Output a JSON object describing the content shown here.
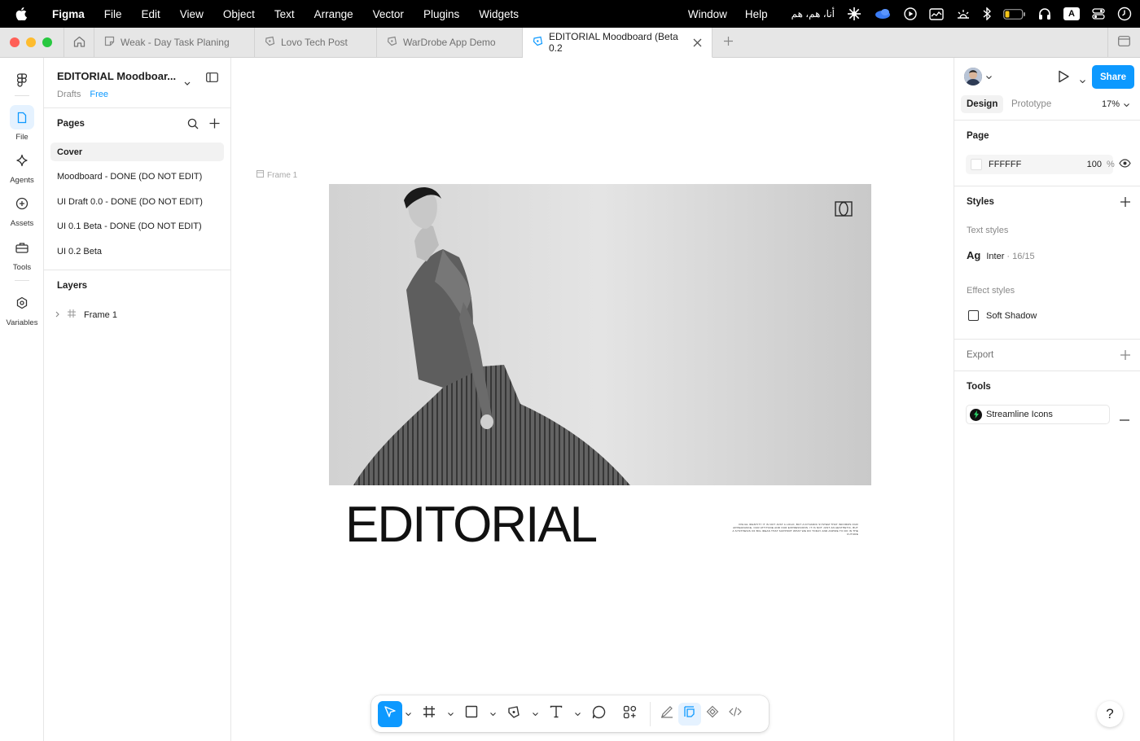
{
  "menubar": {
    "app_name": "Figma",
    "items": [
      "File",
      "Edit",
      "View",
      "Object",
      "Text",
      "Arrange",
      "Vector",
      "Plugins",
      "Widgets"
    ],
    "right_items": [
      "Window",
      "Help"
    ],
    "arabic_text": "أنا، هم، هم",
    "keyboard_indicator": "A"
  },
  "tabs": {
    "items": [
      {
        "label": "Weak - Day Task Planing",
        "icon": "figjam-icon"
      },
      {
        "label": "Lovo Tech Post",
        "icon": "pen-icon"
      },
      {
        "label": "WarDrobe App Demo",
        "icon": "pen-icon"
      },
      {
        "label": "EDITORIAL Moodboard (Beta 0.2",
        "icon": "pen-icon",
        "active": true
      }
    ]
  },
  "rail": {
    "items": [
      {
        "label": "File",
        "icon": "file-icon",
        "selected": true
      },
      {
        "label": "Agents",
        "icon": "sparkle-icon"
      },
      {
        "label": "Assets",
        "icon": "assets-icon"
      },
      {
        "label": "Tools",
        "icon": "toolbox-icon"
      },
      {
        "label": "Variables",
        "icon": "variables-icon"
      }
    ]
  },
  "file": {
    "title": "EDITORIAL Moodboar...",
    "location": "Drafts",
    "plan": "Free"
  },
  "pages": {
    "header": "Pages",
    "items": [
      {
        "label": "Cover",
        "selected": true
      },
      {
        "label": "Moodboard - DONE (DO NOT EDIT)"
      },
      {
        "label": "UI Draft 0.0 - DONE (DO NOT EDIT)"
      },
      {
        "label": "UI 0.1 Beta - DONE (DO NOT EDIT)"
      },
      {
        "label": "UI 0.2 Beta"
      }
    ]
  },
  "layers": {
    "header": "Layers",
    "items": [
      {
        "label": "Frame 1",
        "icon": "frame-icon"
      }
    ]
  },
  "canvas": {
    "frame_label": "Frame 1",
    "title": "EDITORIAL",
    "body_text": "VISUAL IDENTITY IT IS NOT JUST A LOGO, BUT A DYNAMIC SYSTEM THAT INFORMS OUR APPEARANCE, OUR ATTITUDE AND OUR EXPRESSIONS. IT IS NOT JUST AN AESTHETIC, BUT A SYNTHESIS OF BIG IDEAS THAT SUPPORT WHAT WE DO TODAY AND ASPIRE TO DO IN THE FUTURE"
  },
  "toolbar": {
    "tools": [
      "move-icon",
      "frame-icon",
      "rectangle-icon",
      "pen-icon",
      "text-icon",
      "comment-icon",
      "actions-icon"
    ],
    "modes": [
      "draw-icon",
      "design-icon",
      "dev-component-icon",
      "code-icon"
    ]
  },
  "rightpanel": {
    "share_label": "Share",
    "tabs": [
      "Design",
      "Prototype"
    ],
    "zoom": "17%",
    "page_section": "Page",
    "page_color": "FFFFFF",
    "page_opacity": "100",
    "percent": "%",
    "styles_section": "Styles",
    "text_styles_label": "Text styles",
    "text_style": {
      "sample": "Ag",
      "name": "Inter",
      "sep": " · ",
      "meta": "16/15"
    },
    "effect_styles_label": "Effect styles",
    "effect_style": "Soft Shadow",
    "export_section": "Export",
    "tools_section": "Tools",
    "plugin": "Streamline Icons",
    "help": "?"
  },
  "colors": {
    "accent": "#0d99ff",
    "menubar": "#000000",
    "tabbar": "#e6e6e6"
  }
}
